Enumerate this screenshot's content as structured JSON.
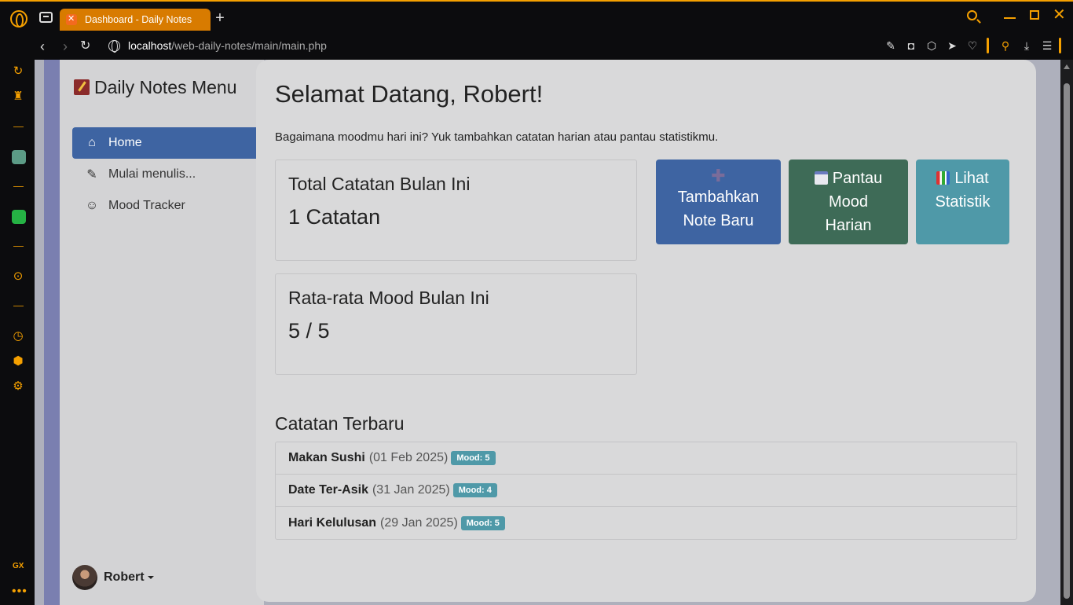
{
  "browser": {
    "tab_title": "Dashboard - Daily Notes",
    "url_host": "localhost",
    "url_path": "/web-daily-notes/main/main.php",
    "sidebar_label": "GX",
    "accent_color": "#f5a000"
  },
  "app": {
    "brand": "Daily Notes Menu",
    "menu": [
      {
        "label": "Home",
        "icon": "home-icon",
        "active": true
      },
      {
        "label": "Mulai menulis...",
        "icon": "pencil-icon",
        "active": false
      },
      {
        "label": "Mood Tracker",
        "icon": "smiley-icon",
        "active": false
      }
    ],
    "user": {
      "name": "Robert"
    }
  },
  "main": {
    "greeting": "Selamat Datang, Robert!",
    "subtitle": "Bagaimana moodmu hari ini? Yuk tambahkan catatan harian atau pantau statistikmu.",
    "cards": [
      {
        "title": "Total Catatan Bulan Ini",
        "value": "1 Catatan"
      },
      {
        "title": "Rata-rata Mood Bulan Ini",
        "value": "5 / 5"
      }
    ],
    "actions": [
      {
        "label_line1": "Tambahkan",
        "label_line2": "Note Baru",
        "icon": "plus-icon",
        "color": "#3e64a2"
      },
      {
        "label_line1": "Pantau",
        "label_line2": "Mood",
        "label_line3": "Harian",
        "icon": "calendar-icon",
        "color": "#3e6b57"
      },
      {
        "label_line1": "Lihat",
        "label_line2": "Statistik",
        "icon": "chart-icon",
        "color": "#4f99a8"
      }
    ],
    "recent_title": "Catatan Terbaru",
    "recent_notes": [
      {
        "title": "Makan Sushi",
        "date": "(01 Feb 2025)",
        "mood": "Mood: 5"
      },
      {
        "title": "Date Ter-Asik",
        "date": "(31 Jan 2025)",
        "mood": "Mood: 4"
      },
      {
        "title": "Hari Kelulusan",
        "date": "(29 Jan 2025)",
        "mood": "Mood: 5"
      }
    ]
  }
}
